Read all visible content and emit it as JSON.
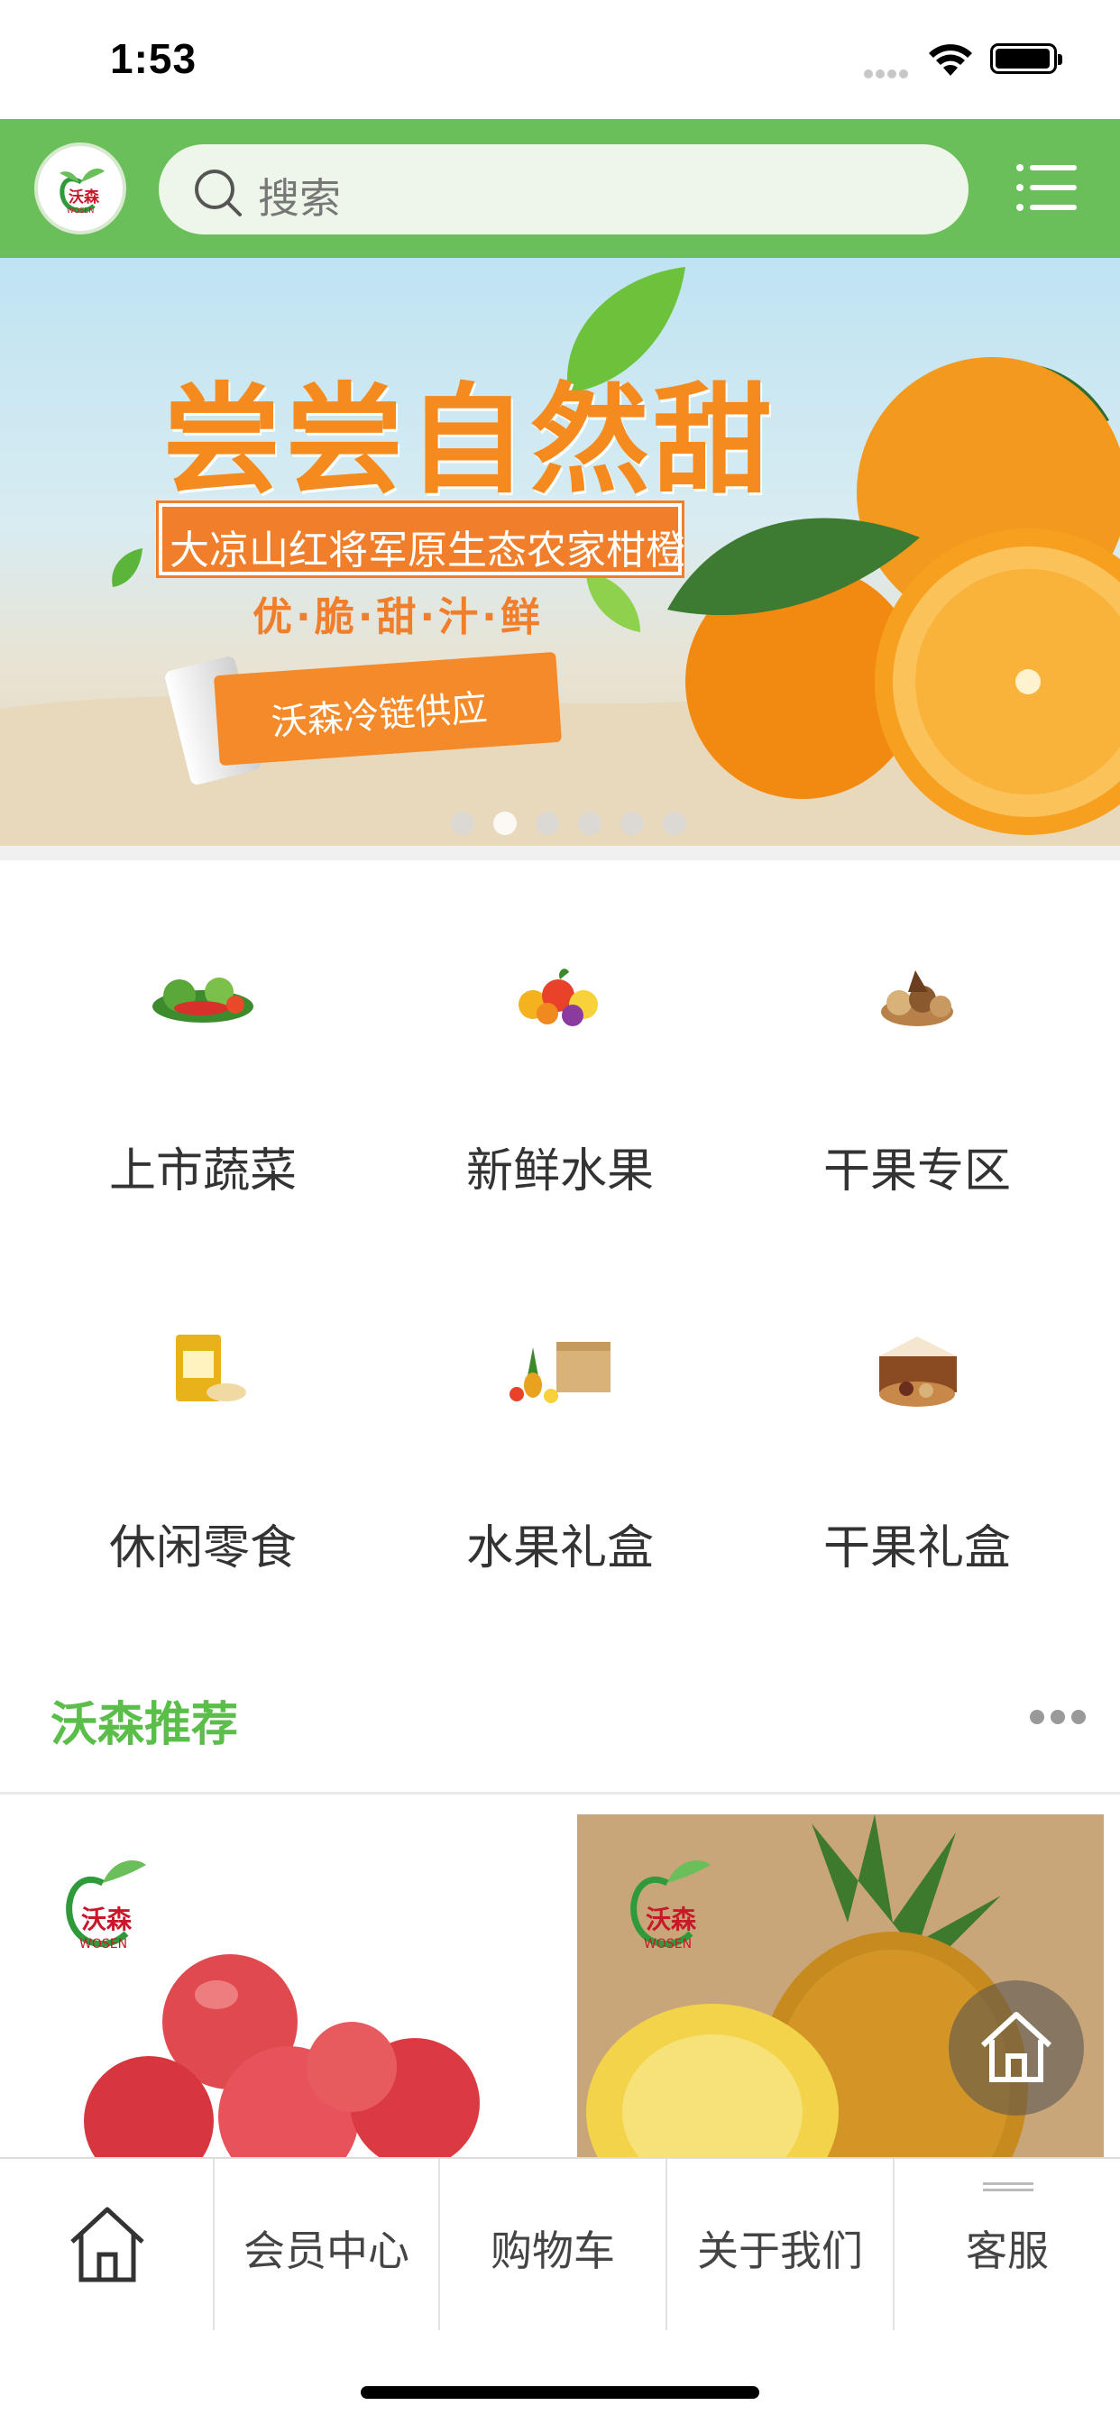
{
  "status_bar": {
    "time": "1:53"
  },
  "header": {
    "logo_text": "沃森",
    "logo_subtext": "WOSEN",
    "search_placeholder": "搜索"
  },
  "banner": {
    "title": "尝尝自然甜",
    "subtitle": "大凉山红将军原生态农家柑橙",
    "tagline": "优·脆·甜·汁·鲜",
    "ribbon": "沃森冷链供应",
    "slide_count": 6,
    "active_slide": 2
  },
  "categories": [
    {
      "label": "上市蔬菜",
      "icon": "vegetables-icon"
    },
    {
      "label": "新鲜水果",
      "icon": "fruits-icon"
    },
    {
      "label": "干果专区",
      "icon": "nuts-icon"
    },
    {
      "label": "休闲零食",
      "icon": "snacks-icon"
    },
    {
      "label": "水果礼盒",
      "icon": "fruit-gift-box-icon"
    },
    {
      "label": "干果礼盒",
      "icon": "nut-gift-box-icon"
    }
  ],
  "recommend": {
    "title": "沃森推荐"
  },
  "products": [
    {
      "brand": "沃森",
      "brand_en": "WOSEN",
      "image": "apples-image"
    },
    {
      "brand": "沃森",
      "brand_en": "WOSEN",
      "image": "pineapple-image"
    }
  ],
  "tabs": [
    {
      "label": "",
      "icon": "home-icon"
    },
    {
      "label": "会员中心"
    },
    {
      "label": "购物车"
    },
    {
      "label": "关于我们"
    },
    {
      "label": "客服"
    }
  ],
  "colors": {
    "brand_green": "#6abf5a",
    "accent_orange": "#f58a1f",
    "title_green": "#5bbd4a"
  }
}
